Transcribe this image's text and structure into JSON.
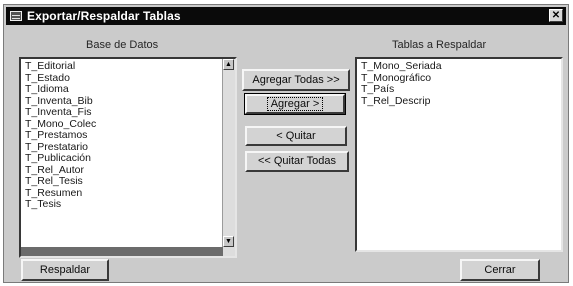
{
  "window": {
    "title": "Exportar/Respaldar Tablas",
    "close_symbol": "✕"
  },
  "left_panel": {
    "label": "Base de Datos",
    "items": [
      "T_Editorial",
      "T_Estado",
      "T_Idioma",
      "T_Inventa_Bib",
      "T_Inventa_Fis",
      "T_Mono_Colec",
      "T_Prestamos",
      "T_Prestatario",
      "T_Publicación",
      "T_Rel_Autor",
      "T_Rel_Tesis",
      "T_Resumen",
      "T_Tesis"
    ]
  },
  "right_panel": {
    "label": "Tablas a Respaldar",
    "items": [
      "T_Mono_Seriada",
      "T_Monográfico",
      "T_País",
      "T_Rel_Descrip"
    ]
  },
  "buttons": {
    "add_all": "Agregar Todas >>",
    "add": "Agregar >",
    "remove": "< Quitar",
    "remove_all": "<< Quitar Todas",
    "backup": "Respaldar",
    "close": "Cerrar"
  },
  "icons": {
    "scroll_up": "▲",
    "scroll_down": "▼"
  }
}
